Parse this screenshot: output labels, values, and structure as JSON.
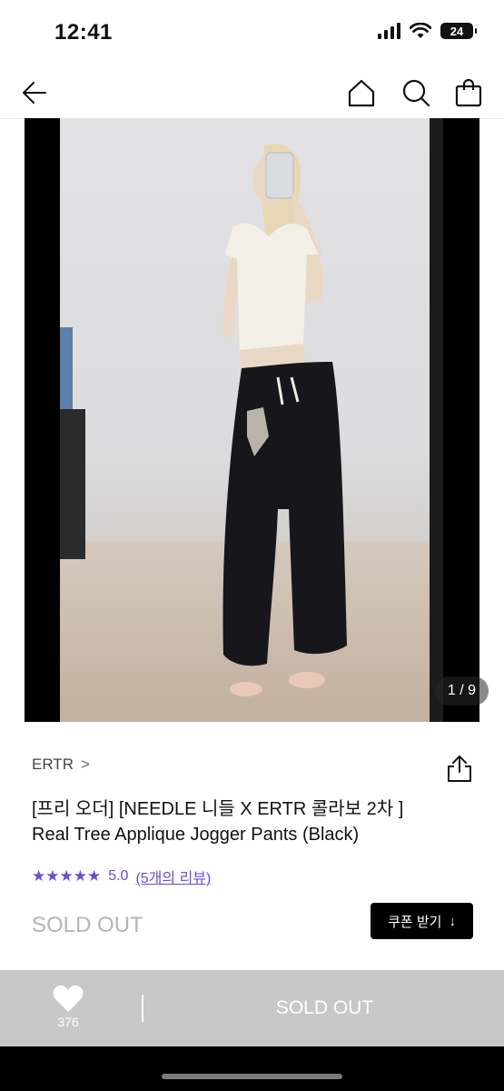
{
  "status_bar": {
    "time": "12:41",
    "battery": "24"
  },
  "nav": {
    "back_icon": "back-arrow-icon",
    "home_icon": "home-icon",
    "search_icon": "search-icon",
    "cart_icon": "shopping-bag-icon"
  },
  "gallery": {
    "pager": "1 / 9"
  },
  "product": {
    "brand": "ERTR",
    "brand_chevron": ">",
    "title_line1": "[프리 오더] [NEEDLE 니들 X ERTR 콜라보 2차 ]",
    "title_line2": "Real Tree Applique Jogger Pants (Black)",
    "stars": "★★★★★",
    "rating": "5.0",
    "review_count": "(5개의 리뷰)",
    "sold_out": "SOLD OUT",
    "coupon_label": "쿠폰 받기",
    "coupon_icon": "↓"
  },
  "bottom_bar": {
    "like_count": "376",
    "sold_out": "SOLD OUT"
  },
  "colors": {
    "accent": "#6e4bd8",
    "bottom_bar": "#c8c8c8",
    "coupon_bg": "#000000"
  }
}
